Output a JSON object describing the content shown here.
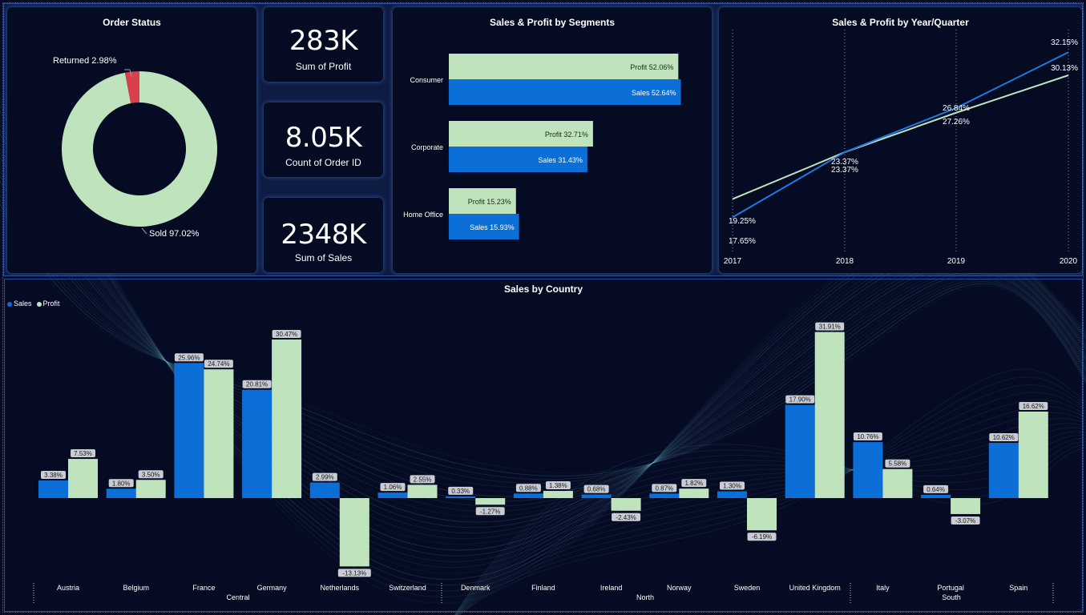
{
  "colors": {
    "sales": "#0b6fd7",
    "profit": "#bfe3bd",
    "returned": "#d9404c",
    "background": "#040b22"
  },
  "order_status": {
    "title": "Order Status",
    "returned_label": "Returned 2.98%",
    "sold_label": "Sold 97.02%",
    "returned_pct": 2.98,
    "sold_pct": 97.02
  },
  "kpis": {
    "profit": {
      "value": "283K",
      "label": "Sum of Profit"
    },
    "orders": {
      "value": "8.05K",
      "label": "Count of Order ID"
    },
    "sales": {
      "value": "2348K",
      "label": "Sum of Sales"
    }
  },
  "segments": {
    "title": "Sales & Profit by Segments",
    "rows": [
      {
        "name": "Consumer",
        "profit": 52.06,
        "sales": 52.64,
        "profit_label": "Profit 52.06%",
        "sales_label": "Sales 52.64%"
      },
      {
        "name": "Corporate",
        "profit": 32.71,
        "sales": 31.43,
        "profit_label": "Profit 32.71%",
        "sales_label": "Sales 31.43%"
      },
      {
        "name": "Home Office",
        "profit": 15.23,
        "sales": 15.93,
        "profit_label": "Profit 15.23%",
        "sales_label": "Sales 15.93%"
      }
    ]
  },
  "year_chart": {
    "title": "Sales & Profit by Year/Quarter",
    "years": [
      "2017",
      "2018",
      "2019",
      "2020"
    ],
    "sales": [
      17.65,
      23.37,
      27.26,
      32.15
    ],
    "profit": [
      19.25,
      23.37,
      26.84,
      30.13
    ],
    "sales_labels": [
      "17.65%",
      "23.37%",
      "27.26%",
      "32.15%"
    ],
    "profit_labels": [
      "19.25%",
      "23.37%",
      "26.84%",
      "30.13%"
    ]
  },
  "country_chart": {
    "title": "Sales by Country",
    "legend_sales": "Sales",
    "legend_profit": "Profit",
    "regions": [
      {
        "name": "Central",
        "countries": [
          "Austria",
          "Belgium",
          "France",
          "Germany",
          "Netherlands",
          "Switzerland"
        ]
      },
      {
        "name": "North",
        "countries": [
          "Denmark",
          "Finland",
          "Ireland",
          "Norway",
          "Sweden",
          "United Kingdom"
        ]
      },
      {
        "name": "South",
        "countries": [
          "Italy",
          "Portugal",
          "Spain"
        ]
      }
    ]
  },
  "chart_data": [
    {
      "type": "pie",
      "title": "Order Status",
      "categories": [
        "Returned",
        "Sold"
      ],
      "values": [
        2.98,
        97.02
      ]
    },
    {
      "type": "bar",
      "title": "Sales & Profit by Segments",
      "categories": [
        "Consumer",
        "Corporate",
        "Home Office"
      ],
      "series": [
        {
          "name": "Profit",
          "values": [
            52.06,
            32.71,
            15.23
          ]
        },
        {
          "name": "Sales",
          "values": [
            52.64,
            31.43,
            15.93
          ]
        }
      ]
    },
    {
      "type": "line",
      "title": "Sales & Profit by Year/Quarter",
      "x": [
        "2017",
        "2018",
        "2019",
        "2020"
      ],
      "series": [
        {
          "name": "Sales",
          "values": [
            17.65,
            23.37,
            27.26,
            32.15
          ]
        },
        {
          "name": "Profit",
          "values": [
            19.25,
            23.37,
            26.84,
            30.13
          ]
        }
      ]
    },
    {
      "type": "bar",
      "title": "Sales by Country",
      "categories": [
        "Austria",
        "Belgium",
        "France",
        "Germany",
        "Netherlands",
        "Switzerland",
        "Denmark",
        "Finland",
        "Ireland",
        "Norway",
        "Sweden",
        "United Kingdom",
        "Italy",
        "Portugal",
        "Spain"
      ],
      "series": [
        {
          "name": "Sales",
          "values": [
            3.38,
            1.8,
            25.96,
            20.81,
            2.99,
            1.06,
            0.33,
            0.88,
            0.68,
            0.87,
            1.3,
            17.9,
            10.76,
            0.64,
            10.62
          ]
        },
        {
          "name": "Profit",
          "values": [
            7.53,
            3.5,
            24.74,
            30.47,
            -13.13,
            2.55,
            -1.27,
            1.38,
            -2.43,
            1.82,
            -6.19,
            31.91,
            5.58,
            -3.07,
            16.62
          ]
        }
      ],
      "legend": "top-left"
    }
  ]
}
